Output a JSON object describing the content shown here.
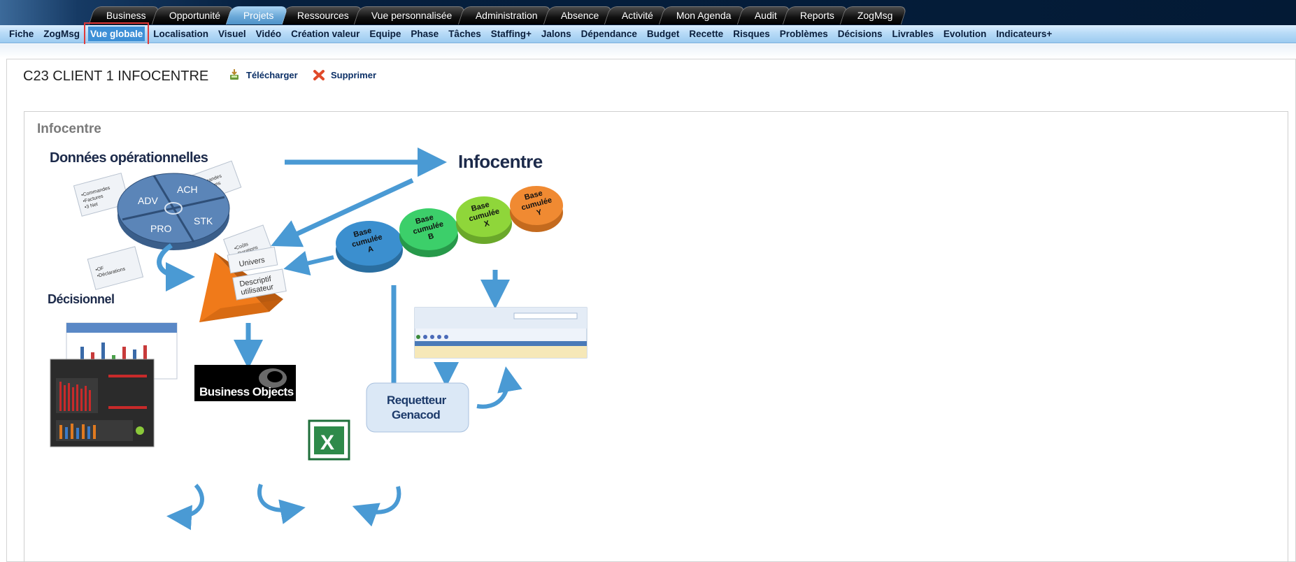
{
  "top_tabs": [
    "Business",
    "Opportunité",
    "Projets",
    "Ressources",
    "Vue personnalisée",
    "Administration",
    "Absence",
    "Activité",
    "Mon Agenda",
    "Audit",
    "Reports",
    "ZogMsg"
  ],
  "active_top_tab": "Projets",
  "sub_nav": [
    "Fiche",
    "ZogMsg",
    "Vue globale",
    "Localisation",
    "Visuel",
    "Vidéo",
    "Création valeur",
    "Equipe",
    "Phase",
    "Tâches",
    "Staffing+",
    "Jalons",
    "Dépendance",
    "Budget",
    "Recette",
    "Risques",
    "Problèmes",
    "Décisions",
    "Livrables",
    "Evolution",
    "Indicateurs+"
  ],
  "active_sub_nav": "Vue globale",
  "page": {
    "title": "C23 CLIENT 1 INFOCENTRE",
    "download_label": "Télécharger",
    "delete_label": "Supprimer",
    "section_title": "Infocentre"
  },
  "diagram": {
    "heading_operational": "Données opérationnelles",
    "heading_infocentre": "Infocentre",
    "heading_decisionnel": "Décisionnel",
    "wheel_segments": [
      "ADV",
      "ACH",
      "PRO",
      "STK"
    ],
    "card_left": [
      "•Commandes",
      "•Factures",
      "•3 Net"
    ],
    "card_top": [
      "•Commandes",
      "•Réceptions"
    ],
    "card_bottom_left": [
      "•OF",
      "•Déclarations"
    ],
    "card_right": [
      "•Coûts",
      "•Rotations"
    ],
    "bases": [
      {
        "line1": "Base",
        "line2": "cumulée",
        "line3": "A",
        "color": "#3b8fcf"
      },
      {
        "line1": "Base",
        "line2": "cumulée",
        "line3": "B",
        "color": "#3ccf6a"
      },
      {
        "line1": "Base",
        "line2": "cumulée",
        "line3": "X",
        "color": "#8fd63a"
      },
      {
        "line1": "Base",
        "line2": "cumulée",
        "line3": "Y",
        "color": "#f08a32"
      }
    ],
    "pyramid_labels": {
      "univers": "Univers",
      "descriptif_line1": "Descriptif",
      "descriptif_line2": "utilisateur"
    },
    "business_objects": "Business Objects",
    "requeteur_line1": "Requetteur",
    "requeteur_line2": "Genacod",
    "excel_letter": "X"
  }
}
